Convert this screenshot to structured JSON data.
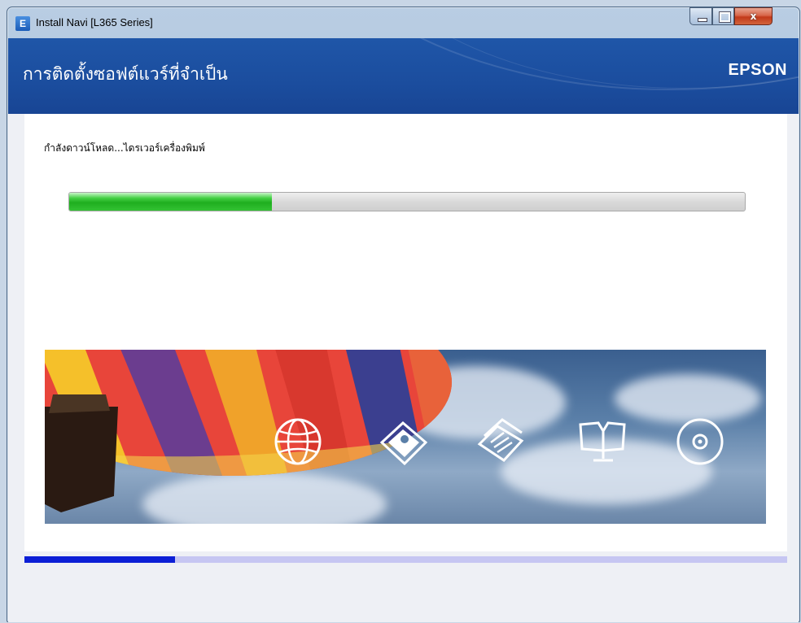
{
  "window": {
    "title": "Install Navi [L365 Series]",
    "app_icon_letter": "E",
    "controls": {
      "minimize": "minimize",
      "maximize": "maximize",
      "close": "x"
    }
  },
  "header": {
    "title": "การติดตั้งซอฟต์แวร์ที่จำเป็น",
    "brand": "EPSON"
  },
  "status": {
    "message": "กำลังดาวน์โหลด...ไดรเวอร์เครื่องพิมพ์",
    "progress_fraction": 0.3
  },
  "banner": {
    "icons": [
      "globe-icon",
      "photo-icon",
      "documents-icon",
      "manual-icon",
      "cd-icon"
    ]
  },
  "steps_progress_fraction": 0.197,
  "colors": {
    "header_blue": "#1b4d9e",
    "progress_green": "#22b022",
    "step_bar_fill": "#0c1fd6",
    "step_bar_track": "#c6c6f2"
  }
}
